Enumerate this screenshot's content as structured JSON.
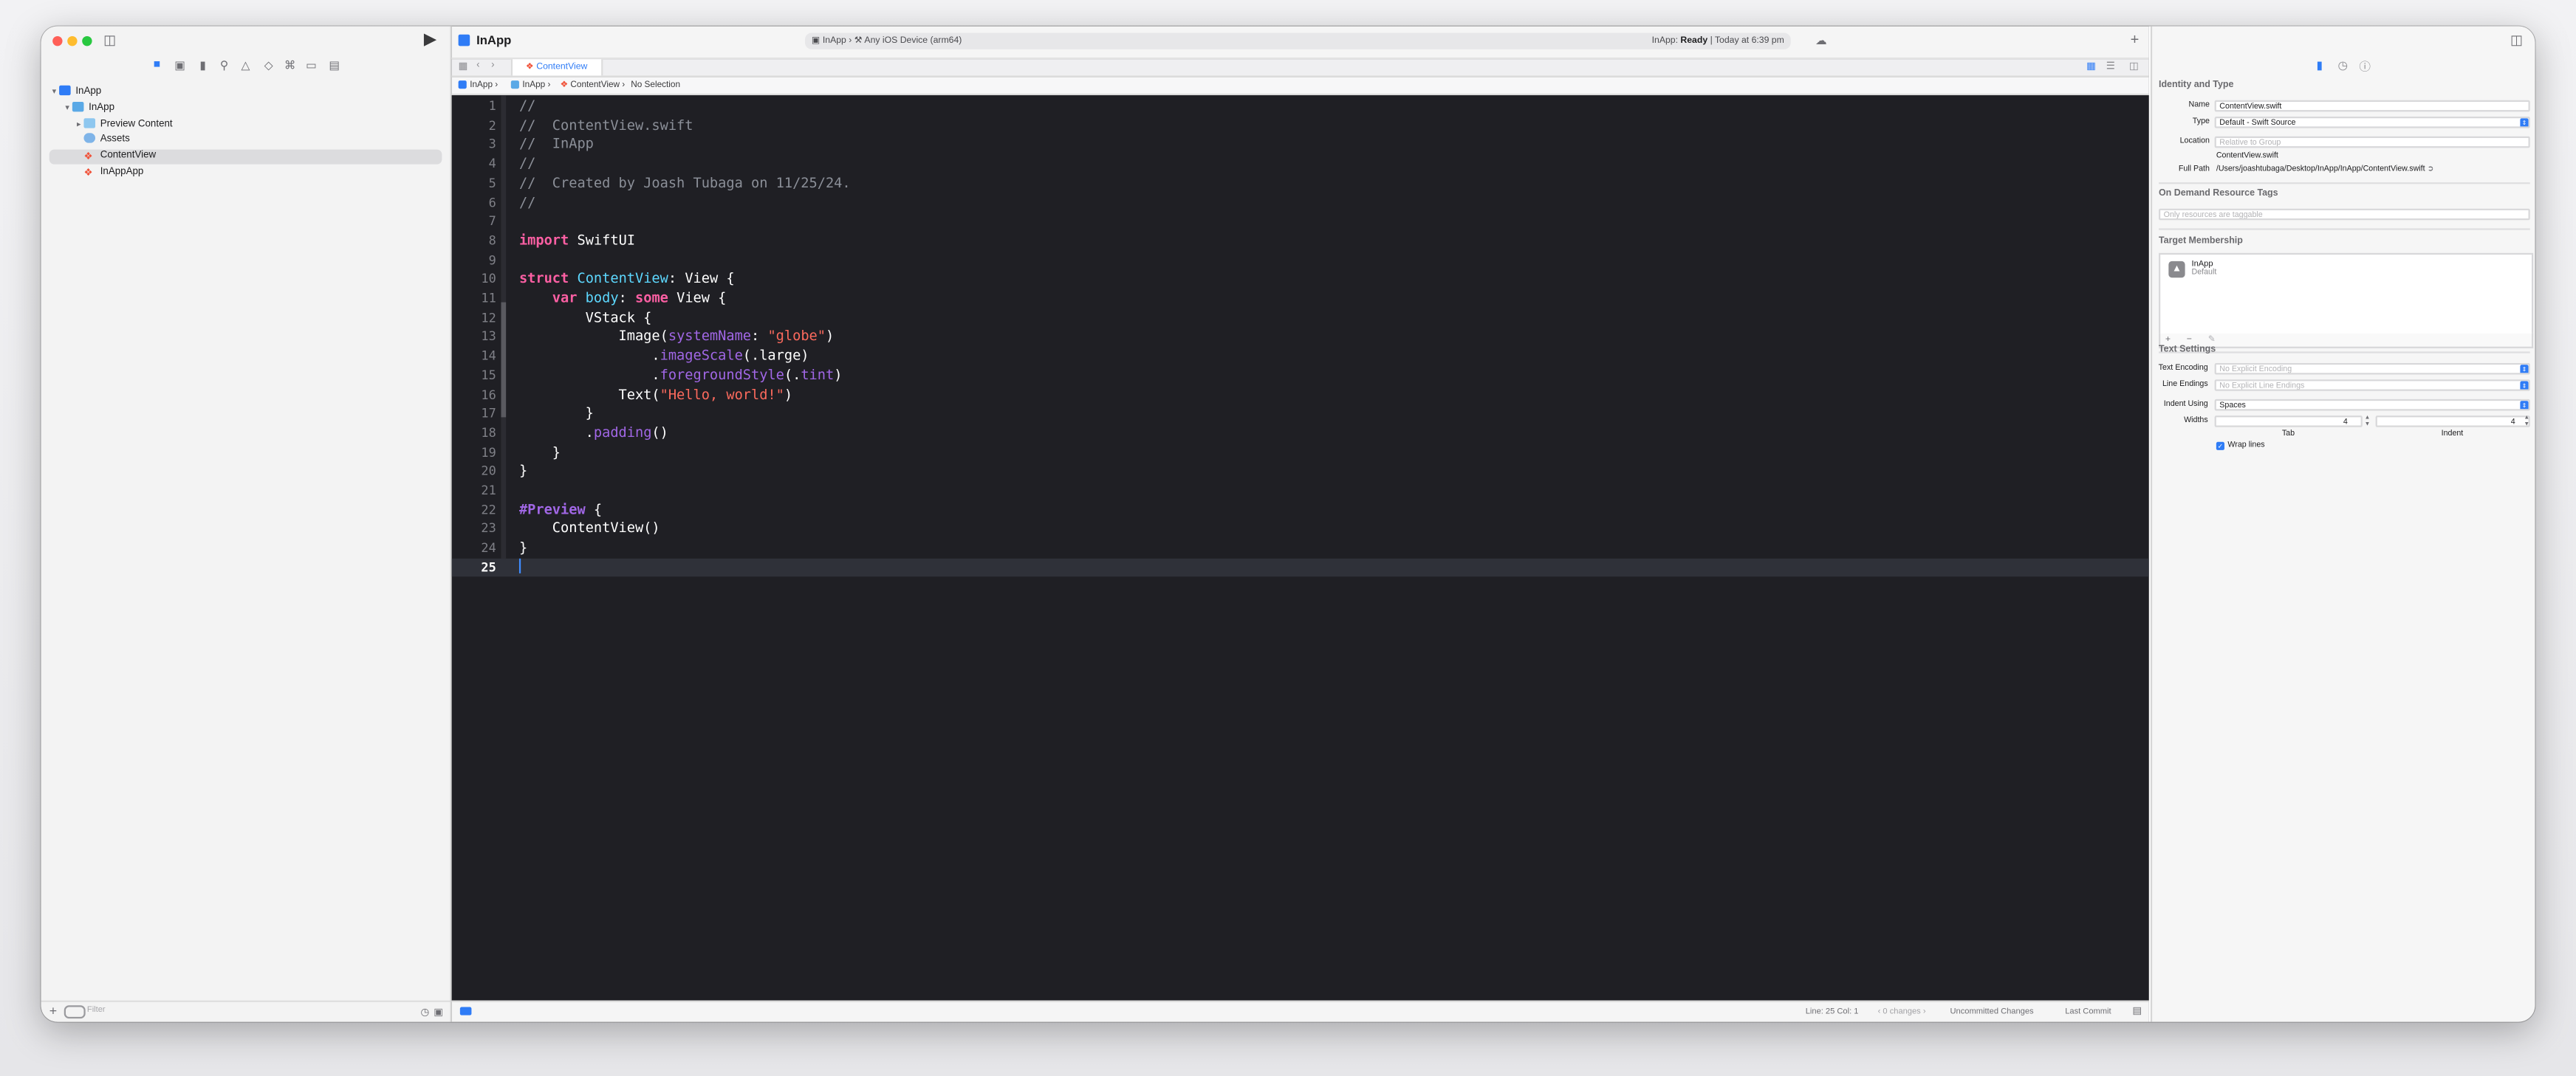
{
  "window": {
    "project_title": "InApp",
    "scheme_target": "InApp",
    "scheme_device": "Any iOS Device (arm64)",
    "status_prefix": "InApp:",
    "status_state": "Ready",
    "status_time": "| Today at 6:39 pm"
  },
  "navigator": {
    "items": [
      {
        "label": "InApp",
        "icon": "app-icon"
      },
      {
        "label": "InApp",
        "icon": "folder-icon"
      },
      {
        "label": "Preview Content",
        "icon": "folder-icon"
      },
      {
        "label": "Assets",
        "icon": "asset-catalog-icon"
      },
      {
        "label": "ContentView",
        "icon": "swift-file-icon"
      },
      {
        "label": "InAppApp",
        "icon": "swift-file-icon"
      }
    ],
    "selected_item": "ContentView",
    "filter_placeholder": "Filter"
  },
  "editor": {
    "tab_label": "ContentView",
    "breadcrumb": [
      "InApp",
      "InApp",
      "ContentView",
      "No Selection"
    ],
    "lines": [
      "1",
      "2",
      "3",
      "4",
      "5",
      "6",
      "7",
      "8",
      "9",
      "10",
      "11",
      "12",
      "13",
      "14",
      "15",
      "16",
      "17",
      "18",
      "19",
      "20",
      "21",
      "22",
      "23",
      "24",
      "25"
    ],
    "code": {
      "l1": "//",
      "l2": "//  ContentView.swift",
      "l3": "//  InApp",
      "l4": "//",
      "l5": "//  Created by Joash Tubaga on 11/25/24.",
      "l6": "//",
      "kw_import": "import",
      "mod_swiftui": " SwiftUI",
      "kw_struct": "struct",
      "type_contentview": " ContentView",
      "colon_view": ": View {",
      "kw_var": "    var",
      "body": " body",
      "colon": ": ",
      "kw_some": "some",
      "view_brace": " View {",
      "vstack": "        VStack {",
      "image_open": "            Image(",
      "systemName": "systemName",
      "colon2": ": ",
      "str_globe": "\"globe\"",
      "close_paren": ")",
      "dot1": "                .",
      "imageScale": "imageScale",
      "large_arg": "(.large)",
      "dot2": "                .",
      "foregroundStyle": "foregroundStyle",
      "paren_open": "(.",
      "tint": "tint",
      "text_open": "            Text(",
      "str_hello": "\"Hello, world!\"",
      "brace_close_8": "        }",
      "dot3": "        .",
      "padding": "padding",
      "parens": "()",
      "brace_close_4": "    }",
      "brace_close_0": "}",
      "macro_preview": "#Preview",
      "preview_brace": " {",
      "contentview_call": "    ContentView()",
      "brace_close_last": "}"
    },
    "status": {
      "position": "Line: 25  Col: 1",
      "changes": "0 changes",
      "uncommitted": "Uncommitted Changes",
      "last_commit": "Last Commit"
    }
  },
  "inspector": {
    "identity_title": "Identity and Type",
    "name_label": "Name",
    "name_value": "ContentView.swift",
    "type_label": "Type",
    "type_value": "Default - Swift Source",
    "location_label": "Location",
    "location_value": "Relative to Group",
    "location_file": "ContentView.swift",
    "fullpath_label": "Full Path",
    "fullpath_value": "/Users/joashtubaga/Desktop/InApp/InApp/ContentView.swift",
    "odr_title": "On Demand Resource Tags",
    "odr_placeholder": "Only resources are taggable",
    "target_title": "Target Membership",
    "target_name": "InApp",
    "target_sub": "Default",
    "text_settings_title": "Text Settings",
    "encoding_label": "Text Encoding",
    "encoding_value": "No Explicit Encoding",
    "line_endings_label": "Line Endings",
    "line_endings_value": "No Explicit Line Endings",
    "indent_label": "Indent Using",
    "indent_value": "Spaces",
    "widths_label": "Widths",
    "tab_width": "4",
    "indent_width": "4",
    "tab_caption": "Tab",
    "indent_caption": "Indent",
    "wrap_label": "Wrap lines"
  },
  "colors": {
    "accent": "#2f7cf6",
    "editor_bg": "#1f1f24",
    "keyword": "#fc5fa3",
    "string": "#fc6a5d",
    "comment": "#8b8f98",
    "type": "#5dd8ff"
  }
}
